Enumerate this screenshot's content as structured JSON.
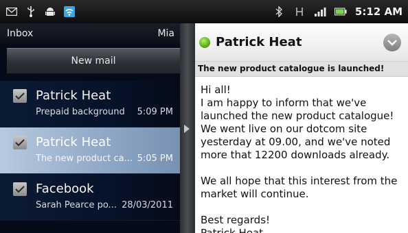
{
  "status_bar": {
    "time": "5:12 AM",
    "icons_left": [
      "notification-mail-icon",
      "usb-icon",
      "android-debug-icon",
      "wifi-icon"
    ],
    "icons_right": [
      "bluetooth-icon",
      "network-h-icon",
      "signal-icon",
      "battery-icon"
    ]
  },
  "inbox": {
    "folder": "Inbox",
    "account": "Mia",
    "new_mail_label": "New mail",
    "messages": [
      {
        "from": "Patrick Heat",
        "subject": "Prepaid background",
        "date": "5:09 PM",
        "selected": false
      },
      {
        "from": "Patrick Heat",
        "subject": "The new product ca...",
        "date": "5:05 PM",
        "selected": true
      },
      {
        "from": "Facebook",
        "subject": "Sarah Pearce po...",
        "date": "28/03/2011",
        "selected": false
      }
    ]
  },
  "reading_pane": {
    "sender": "Patrick Heat",
    "subject": "The new product catalogue is launched!",
    "body": [
      "Hi all!",
      "I am happy to inform that we've launched the new product catalogue! We went live on our dotcom site yesterday at 09.00, and we've noted more that 12200 downloads already.",
      "",
      "We all hope that this interest from the market will continue.",
      "",
      "Best regards!",
      "Patrick Heat"
    ]
  },
  "colors": {
    "selected_row": "#9fb4d0",
    "presence_green": "#4ea10c",
    "status_bar": "#111111"
  }
}
